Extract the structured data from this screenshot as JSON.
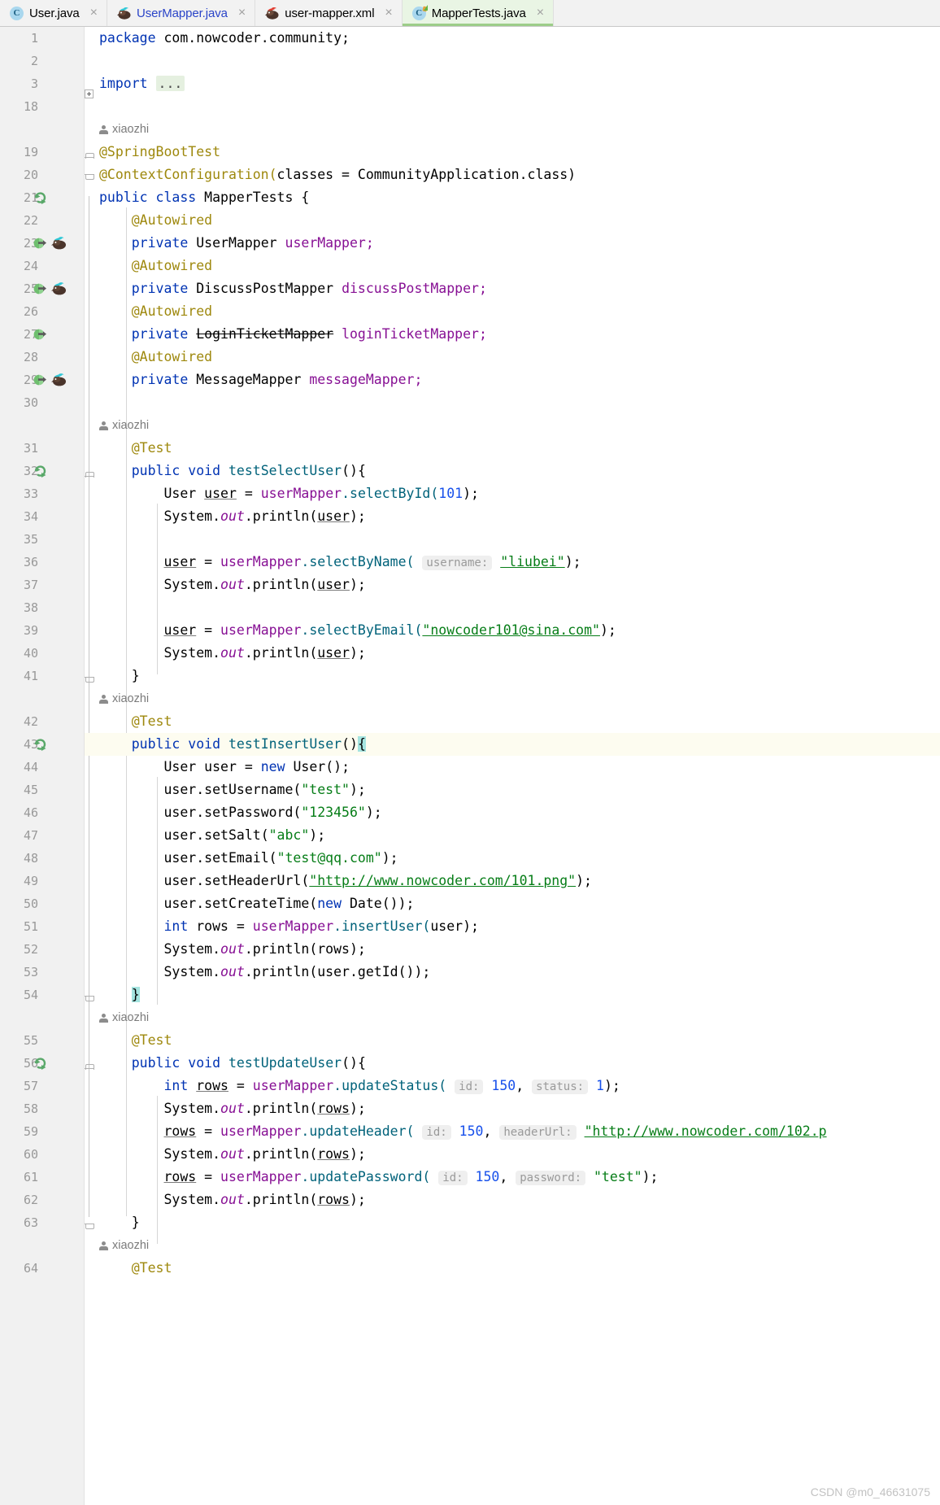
{
  "window": {
    "app": "IntelliJ IDEA Editor",
    "watermark": "CSDN @m0_46631075"
  },
  "tabs": [
    {
      "label": "User.java",
      "icon": "java-class-icon",
      "active": false,
      "blue": false,
      "close": "×"
    },
    {
      "label": "UserMapper.java",
      "icon": "mybatis-bird-icon",
      "active": false,
      "blue": true,
      "close": "×"
    },
    {
      "label": "user-mapper.xml",
      "icon": "mybatis-bird-icon",
      "active": false,
      "blue": false,
      "close": "×"
    },
    {
      "label": "MapperTests.java",
      "icon": "java-test-class-icon",
      "active": true,
      "blue": false,
      "close": "×"
    }
  ],
  "colors": {
    "accent_tab_active": "#e9f5e4",
    "tab_underline": "#9dcd89",
    "gutter_bg": "#f1f1f1",
    "keyword": "#0033b3",
    "string": "#067d17",
    "annotation": "#9e880d",
    "field": "#871094",
    "number": "#1750eb",
    "method": "#00627a",
    "caret_line": "#fdfcf0",
    "selection": "#a5e4e0"
  },
  "author_annotation": "xiaozhi",
  "lines": [
    {
      "n": "1",
      "type": "code"
    },
    {
      "n": "2",
      "type": "code"
    },
    {
      "n": "3",
      "type": "code"
    },
    {
      "n": "18",
      "type": "code"
    },
    {
      "n": "",
      "type": "annot"
    },
    {
      "n": "19",
      "type": "code"
    },
    {
      "n": "20",
      "type": "code"
    },
    {
      "n": "21",
      "type": "code"
    },
    {
      "n": "22",
      "type": "code"
    },
    {
      "n": "23",
      "type": "code"
    },
    {
      "n": "24",
      "type": "code"
    },
    {
      "n": "25",
      "type": "code"
    },
    {
      "n": "26",
      "type": "code"
    },
    {
      "n": "27",
      "type": "code"
    },
    {
      "n": "28",
      "type": "code"
    },
    {
      "n": "29",
      "type": "code"
    },
    {
      "n": "30",
      "type": "code"
    },
    {
      "n": "",
      "type": "annot"
    },
    {
      "n": "31",
      "type": "code"
    },
    {
      "n": "32",
      "type": "code"
    },
    {
      "n": "33",
      "type": "code"
    },
    {
      "n": "34",
      "type": "code"
    },
    {
      "n": "35",
      "type": "code"
    },
    {
      "n": "36",
      "type": "code"
    },
    {
      "n": "37",
      "type": "code"
    },
    {
      "n": "38",
      "type": "code"
    },
    {
      "n": "39",
      "type": "code"
    },
    {
      "n": "40",
      "type": "code"
    },
    {
      "n": "41",
      "type": "code"
    },
    {
      "n": "",
      "type": "annot"
    },
    {
      "n": "42",
      "type": "code"
    },
    {
      "n": "43",
      "type": "code"
    },
    {
      "n": "44",
      "type": "code"
    },
    {
      "n": "45",
      "type": "code"
    },
    {
      "n": "46",
      "type": "code"
    },
    {
      "n": "47",
      "type": "code"
    },
    {
      "n": "48",
      "type": "code"
    },
    {
      "n": "49",
      "type": "code"
    },
    {
      "n": "50",
      "type": "code"
    },
    {
      "n": "51",
      "type": "code"
    },
    {
      "n": "52",
      "type": "code"
    },
    {
      "n": "53",
      "type": "code"
    },
    {
      "n": "54",
      "type": "code"
    },
    {
      "n": "",
      "type": "annot"
    },
    {
      "n": "55",
      "type": "code"
    },
    {
      "n": "56",
      "type": "code"
    },
    {
      "n": "57",
      "type": "code"
    },
    {
      "n": "58",
      "type": "code"
    },
    {
      "n": "59",
      "type": "code"
    },
    {
      "n": "60",
      "type": "code"
    },
    {
      "n": "61",
      "type": "code"
    },
    {
      "n": "62",
      "type": "code"
    },
    {
      "n": "63",
      "type": "code"
    },
    {
      "n": "",
      "type": "annot"
    },
    {
      "n": "64",
      "type": "code"
    }
  ],
  "code_text": {
    "l1": "package com.nowcoder.community;",
    "l3": "import ...",
    "l19": "@SpringBootTest",
    "l20": "@ContextConfiguration(classes = CommunityApplication.class)",
    "l21": "public class MapperTests {",
    "l22": "@Autowired",
    "l23": "private UserMapper userMapper;",
    "l24": "@Autowired",
    "l25": "private DiscussPostMapper discussPostMapper;",
    "l26": "@Autowired",
    "l27": "private LoginTicketMapper loginTicketMapper;",
    "l28": "@Autowired",
    "l29": "private MessageMapper messageMapper;",
    "l31": "@Test",
    "l32": "public void testSelectUser(){",
    "l33": "User user = userMapper.selectById(101);",
    "l34": "System.out.println(user);",
    "l36": "user = userMapper.selectByName( username: \"liubei\");",
    "l37": "System.out.println(user);",
    "l39": "user = userMapper.selectByEmail(\"nowcoder101@sina.com\");",
    "l40": "System.out.println(user);",
    "l41": "}",
    "l42": "@Test",
    "l43": "public void testInsertUser(){",
    "l44": "User user = new User();",
    "l45": "user.setUsername(\"test\");",
    "l46": "user.setPassword(\"123456\");",
    "l47": "user.setSalt(\"abc\");",
    "l48": "user.setEmail(\"test@qq.com\");",
    "l49": "user.setHeaderUrl(\"http://www.nowcoder.com/101.png\");",
    "l50": "user.setCreateTime(new Date());",
    "l51": "int rows = userMapper.insertUser(user);",
    "l52": "System.out.println(rows);",
    "l53": "System.out.println(user.getId());",
    "l54": "}",
    "l55": "@Test",
    "l56": "public void testUpdateUser(){",
    "l57": "int rows = userMapper.updateStatus( id: 150, status: 1);",
    "l58": "System.out.println(rows);",
    "l59": "rows = userMapper.updateHeader( id: 150, headerUrl: \"http://www.nowcoder.com/102.p",
    "l60": "System.out.println(rows);",
    "l61": "rows = userMapper.updatePassword( id: 150, password: \"test\");",
    "l62": "System.out.println(rows);",
    "l63": "}",
    "l64": "@Test"
  },
  "tokens": {
    "kw_package": "package",
    "pkg_name": "com.nowcoder.community;",
    "kw_import": "import",
    "fold_placeholder": "...",
    "ann_springboottest": "@SpringBootTest",
    "ann_contextconfig": "@ContextConfiguration(",
    "classes_eq": "classes = ",
    "community_app": "CommunityApplication",
    "dot_class_paren": ".class)",
    "kw_public": "public",
    "kw_class": "class",
    "cls_mappertests": "MapperTests",
    "brace_open": "{",
    "brace_close": "}",
    "ann_autowired": "@Autowired",
    "kw_private": "private",
    "cls_usermapper": "UserMapper",
    "fld_usermapper": "userMapper;",
    "cls_discusspostmapper": "DiscussPostMapper",
    "fld_discusspostmapper": "discussPostMapper;",
    "cls_loginticketmapper": "LoginTicketMapper",
    "fld_loginticketmapper": "loginTicketMapper;",
    "cls_messagemapper": "MessageMapper",
    "fld_messagemapper": "messageMapper;",
    "ann_test": "@Test",
    "kw_void": "void",
    "m_testselectuser": "testSelectUser",
    "m_testinsertuser": "testInsertUser",
    "m_testupdateuser": "testUpdateUser",
    "parens": "()",
    "cls_user": "User",
    "var_user": "user",
    "eq": " = ",
    "fld_usermapper_ref": "userMapper",
    "m_selectbyid": ".selectById(",
    "num_101": "101",
    "close_semi": ");",
    "sys": "System.",
    "out": "out",
    "println": ".println(",
    "m_selectbyname": ".selectByName(",
    "hint_username": "username:",
    "str_liubei": "\"liubei\"",
    "m_selectbyemail": ".selectByEmail(",
    "str_email": "\"nowcoder101@sina.com\"",
    "kw_new": "new",
    "m_setusername": "user.setUsername(",
    "str_test": "\"test\"",
    "m_setpassword": "user.setPassword(",
    "str_123456": "\"123456\"",
    "m_setsalt": "user.setSalt(",
    "str_abc": "\"abc\"",
    "m_setemail": "user.setEmail(",
    "str_testqq": "\"test@qq.com\"",
    "m_setheaderurl": "user.setHeaderUrl(",
    "str_url101": "\"http://www.nowcoder.com/101.png\"",
    "m_setcreatetime": "user.setCreateTime(",
    "cls_date": "Date",
    "kw_int": "int",
    "var_rows": "rows",
    "m_insertuser": ".insertUser(",
    "var_user_plain": "user",
    "println_rows": "rows",
    "m_getid": "user.getId()",
    "m_updatestatus": ".updateStatus(",
    "hint_id": "id:",
    "num_150": "150",
    "hint_status": "status:",
    "num_1": "1",
    "m_updateheader": ".updateHeader(",
    "hint_headerurl": "headerUrl:",
    "str_url102": "\"http://www.nowcoder.com/102.p",
    "m_updatepassword": ".updatePassword(",
    "hint_password": "password:"
  },
  "gutter_icons": {
    "spring_leaf": "spring-leaf-icon",
    "run_test": "run-test-icon",
    "navigate_impl": "navigate-implementation-icon",
    "mybatis": "mybatis-bird-icon"
  }
}
